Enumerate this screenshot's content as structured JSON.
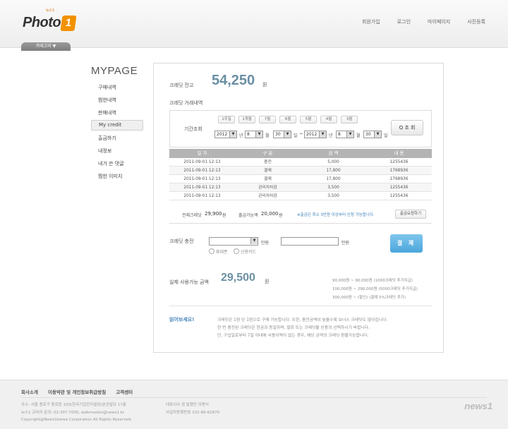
{
  "header": {
    "logo_text": "Photo",
    "logo_badge": "1",
    "logo_mini": "뉴스1",
    "nav": [
      "회원가입",
      "로그인",
      "마이페이지",
      "사진등록"
    ],
    "category_button": "카테고리 ▼"
  },
  "sidebar": {
    "title": "MYPAGE",
    "items": [
      {
        "label": "구매내역"
      },
      {
        "label": "찜한내역"
      },
      {
        "label": "판매내역"
      },
      {
        "label": "My credit"
      },
      {
        "label": "출금하기"
      },
      {
        "label": "내정보"
      },
      {
        "label": "내가 쓴 댓글"
      },
      {
        "label": "찜한 이미지"
      }
    ]
  },
  "credit": {
    "balance_label": "크레딧 잔고",
    "balance_value": "54,250",
    "balance_unit": "원",
    "history_label": "크레딧 거래내역"
  },
  "search": {
    "period_label": "기간조회",
    "period_buttons": [
      "1주일",
      "1개월",
      "7월",
      "6월",
      "5월",
      "4월",
      "3월"
    ],
    "start_year": "2012",
    "start_month": "8",
    "start_day": "30",
    "end_year": "2012",
    "end_month": "8",
    "end_day": "30",
    "year_unit": "년",
    "month_unit": "월",
    "day_unit": "일",
    "tilde": "~",
    "button": "Q 조 회"
  },
  "table": {
    "headers": [
      "일 자",
      "구 분",
      "금 액",
      "내 용"
    ],
    "rows": [
      [
        "2011-09-01 12:13",
        "충전",
        "5,000",
        "1255436"
      ],
      [
        "2011-09-01 12:13",
        "결제",
        "17,800",
        "1768936"
      ],
      [
        "2011-09-01 12:13",
        "결제",
        "17,800",
        "1768936"
      ],
      [
        "2011-09-01 12:13",
        "관리자차감",
        "3,500",
        "1255436"
      ],
      [
        "2011-09-01 12:13",
        "관리자차감",
        "3,500",
        "1255436"
      ]
    ]
  },
  "summary": {
    "total_label": "전체크레딧",
    "total_value": "29,900",
    "total_unit": "원",
    "withdraw_label": "출금가능액",
    "withdraw_value": "20,000",
    "withdraw_unit": "원",
    "notice": "※출금은 최소 3만원 이상부터 신청 가능합니다.",
    "refund_button": "출금요청하기"
  },
  "charge": {
    "label": "크레딧 충전",
    "unit1": "만원",
    "unit2": "만원",
    "radio_phone": "휴대폰",
    "radio_card": "신용카드",
    "pay_button": "결 제"
  },
  "available": {
    "label": "실제 사용가능 금액",
    "value": "29,500",
    "unit": "원",
    "bonus": [
      "90,000원 ~ 90,000원   (1000크레딧 추가지급)",
      "100,000원 ~ 290,000원   (5000크레딧 추가지급)",
      "300,000원 ~ (할인)   (결제 5%크레딧 추가)"
    ]
  },
  "notes": {
    "title": "읽어보세요!",
    "lines": [
      "크레딧은 1원 당 1원으로 구매 가능합니다. 또한, 충전금액이 높을수록 보너스 크레딧도 많아집니다.",
      "한 번 충전된 크레딧은 현금과 동일하며, 철회 또는 크레딧을 신용의 선택하시기 바랍니다.",
      "단, 구입일로부터 7일 이내에 사용이력이 없는 경우, 해당 금액의 크레딧 환불가능합니다."
    ]
  },
  "footer": {
    "links": [
      "회사소개",
      "이용약관 및 개인정보취급방침",
      "고객센터"
    ],
    "address_lines": [
      "주소: 서울 종로구 종로동 100(한국기업진자빌딩(본관빌딩 17층",
      "뉴스1 코리아 문의: 02-397-7000, webmaster@news1.kr",
      "Copyright@News1korea Corporation All Rights Reserved."
    ],
    "ceo_lines": [
      "대표이사 겸 발행인 이명식",
      "사업자등록번호 101-86-62870"
    ],
    "brand": "news1"
  }
}
